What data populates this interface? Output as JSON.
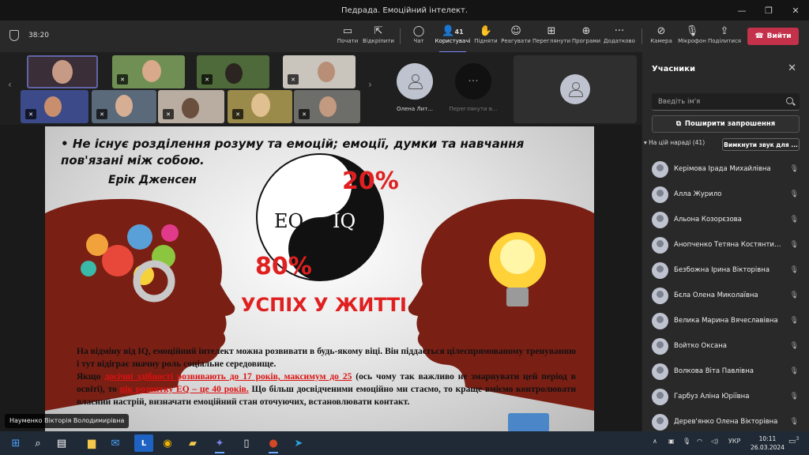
{
  "window": {
    "title": "Педрада. Емоційний інтелект."
  },
  "toolbar": {
    "timer": "38:20",
    "buttons": [
      {
        "label": "Почати",
        "icon": "screen"
      },
      {
        "label": "Відкріпити",
        "icon": "unpin"
      },
      {
        "label": "Чат",
        "icon": "chat"
      },
      {
        "label": "Користувачі",
        "icon": "people",
        "count": "41"
      },
      {
        "label": "Підняти",
        "icon": "hand"
      },
      {
        "label": "Реагувати",
        "icon": "smile"
      },
      {
        "label": "Переглянути",
        "icon": "grid"
      },
      {
        "label": "Програми",
        "icon": "plus"
      },
      {
        "label": "Додатково",
        "icon": "more"
      },
      {
        "label": "Камера",
        "icon": "camera"
      },
      {
        "label": "Мікрофон",
        "icon": "mic-off"
      },
      {
        "label": "Поділитися",
        "icon": "share"
      }
    ],
    "leave_label": "Вийти"
  },
  "gallery": {
    "cards": [
      {
        "name": "Олена Лит..."
      },
      {
        "name": "Переглянути в..."
      }
    ]
  },
  "slide": {
    "bullet": "Не існує розділення розуму та емоцій; емоції, думки та навчання пов'язані між собою.",
    "author": "Ерік Дженсен",
    "eq": "EQ",
    "iq": "IQ",
    "pct_iq": "20%",
    "pct_eq": "80%",
    "success": "УСПІХ У ЖИТТІ",
    "para_1": "На відміну від IQ, емоційний інтелект можна розвивати в будь-якому віці. Він піддається цілеспрямованому тренуванню і тут відіграє значну роль соціальне середовище.",
    "para_2a": "Якщо ",
    "para_2u1": "досічні здібності розвивають до 17 років, максимум до 25",
    "para_2b": " (ось чому так важливо не змарнувати цей період в освіті), то ",
    "para_2u2": "пік розвитку EQ – це 40 років.",
    "para_2c": " Що більш досвідченими емоційно ми стаємо, то краще вміємо контролювати власний настрій, визначати емоційний стан оточуючих, ",
    "para_2d": "встановлювати контакт."
  },
  "speaker_label": "Науменко Вікторія Володимирівна",
  "panel": {
    "title": "Учасники",
    "search_placeholder": "Введіть ім'я",
    "invite_label": "Поширити запрошення",
    "section_label": "На цій нараді (41)",
    "mute_all_label": "Вимкнути звук для ...",
    "participants": [
      "Керімова Ірада Михайлівна",
      "Алла Журило",
      "Альона Козорєзова",
      "Анопченко Тетяна Костянтинів...",
      "Безбожна Ірина Вікторівна",
      "Бєла Олена Миколаївна",
      "Велика Марина Вячеславівна",
      "Войтко Оксана",
      "Волкова Віта Павлівна",
      "Гарбуз Аліна Юріївна",
      "Дерев'янко Олена Вікторівна"
    ]
  },
  "taskbar": {
    "lang": "УКР",
    "time": "10:11",
    "date": "26.03.2024",
    "notifications": "3"
  }
}
